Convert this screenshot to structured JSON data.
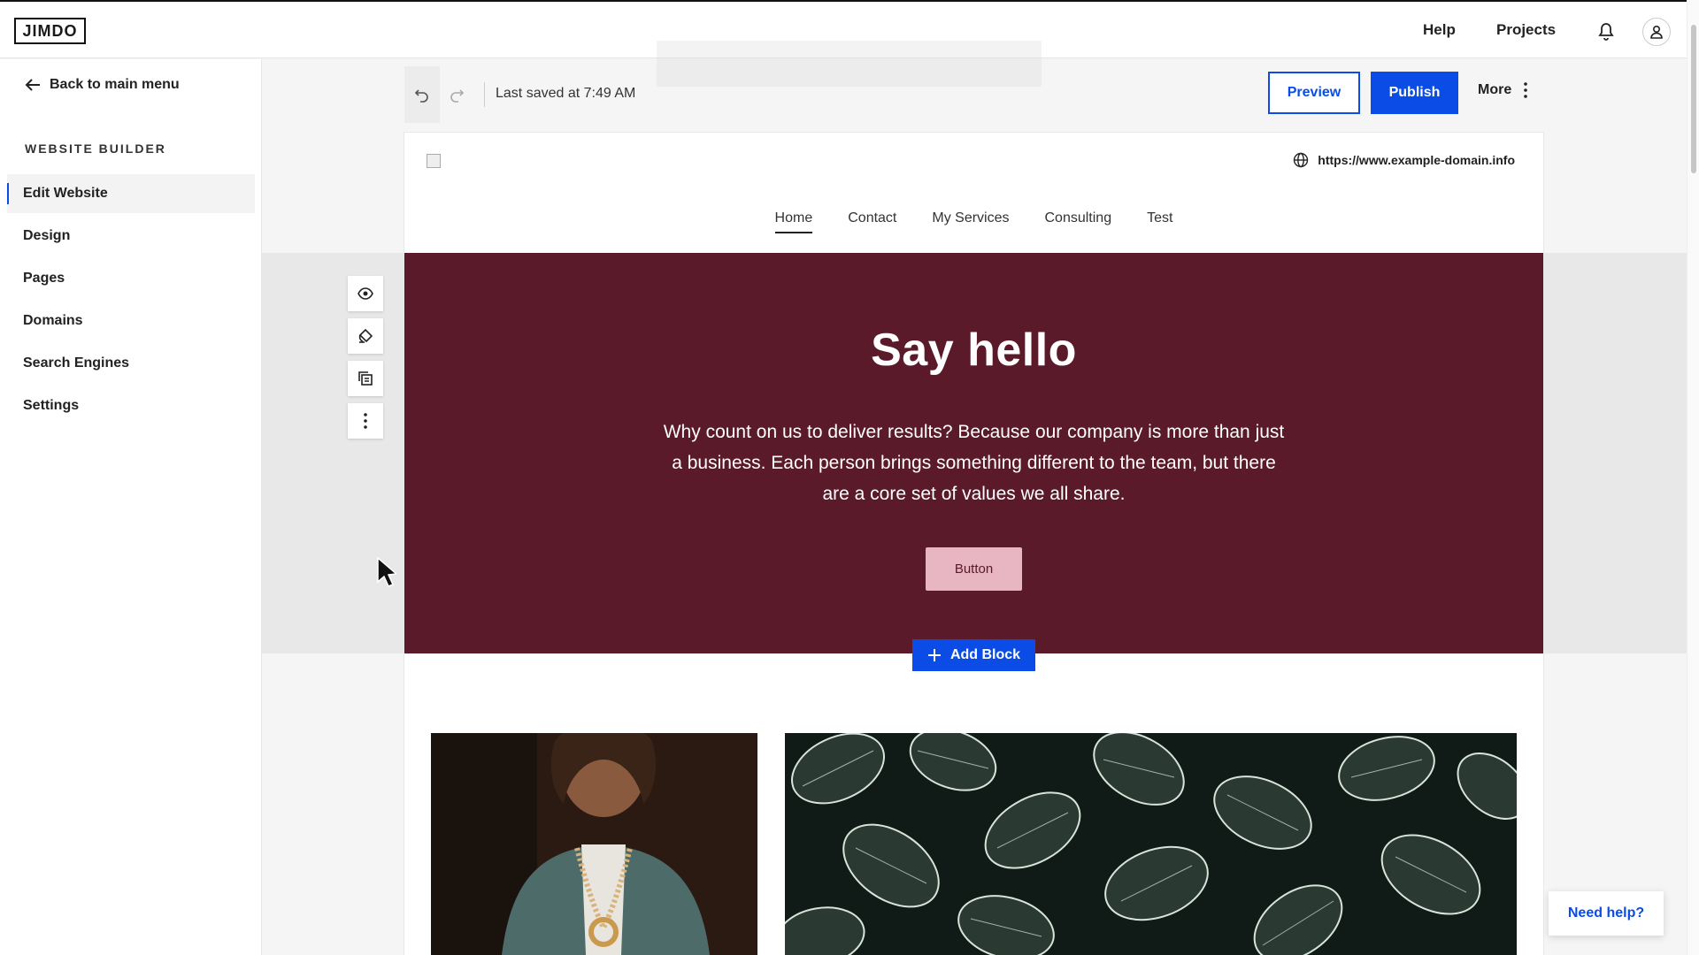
{
  "app": {
    "logo": "JIMDO"
  },
  "topbar": {
    "help": "Help",
    "projects": "Projects"
  },
  "sidebar": {
    "back": "Back to main menu",
    "section": "WEBSITE BUILDER",
    "items": [
      {
        "label": "Edit Website",
        "active": true
      },
      {
        "label": "Design"
      },
      {
        "label": "Pages"
      },
      {
        "label": "Domains"
      },
      {
        "label": "Search Engines"
      },
      {
        "label": "Settings"
      }
    ]
  },
  "toolbar": {
    "last_saved": "Last saved at 7:49 AM",
    "preview": "Preview",
    "publish": "Publish",
    "more": "More"
  },
  "site": {
    "url": "https://www.example-domain.info",
    "nav": [
      "Home",
      "Contact",
      "My Services",
      "Consulting",
      "Test"
    ],
    "hero": {
      "title": "Say hello",
      "text": "Why count on us to deliver results? Because our company is more than just a business. Each person brings something different to the team, but there are a core set of values we all share.",
      "button": "Button"
    },
    "add_block": "Add Block"
  },
  "help_widget": "Need help?",
  "colors": {
    "accent": "#0b4ce6",
    "hero_bg": "#5a1a2a",
    "hero_button": "#e7b6c2"
  }
}
